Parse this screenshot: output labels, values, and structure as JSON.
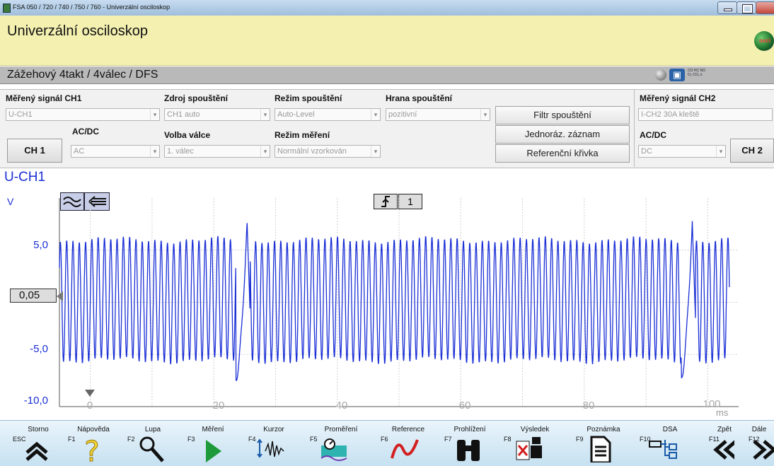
{
  "window": {
    "title": "FSA 050 / 720 / 740 / 750 / 760 - Univerzální osciloskop"
  },
  "app": {
    "title": "Univerzální osciloskop",
    "globe_label": "osci"
  },
  "config": {
    "text": "Zážehový 4takt /  4válec / DFS",
    "gas_icon_text": "CO HC NO O₂ CO₂ λ"
  },
  "panel": {
    "ch1_signal_label": "Měřený signál CH1",
    "ch1_signal_value": "U-CH1",
    "trigger_source_label": "Zdroj spouštění",
    "trigger_source_value": "CH1 auto",
    "trigger_mode_label": "Režim spouštění",
    "trigger_mode_value": "Auto-Level",
    "trigger_edge_label": "Hrana spouštění",
    "trigger_edge_value": "pozitivní",
    "ch1_acdc_label": "AC/DC",
    "ch1_acdc_value": "AC",
    "ch1_button": "CH 1",
    "cylinder_label": "Volba válce",
    "cylinder_value": "1. válec",
    "measure_mode_label": "Režim měření",
    "measure_mode_value": "Normální vzorkován",
    "filter_button": "Filtr spouštění",
    "single_button": "Jednoráz. záznam",
    "reference_button": "Referenční křivka",
    "ch2_signal_label": "Měřený signál CH2",
    "ch2_signal_value": "I-CH2 30A kleště",
    "ch2_acdc_label": "AC/DC",
    "ch2_acdc_value": "DC",
    "ch2_button": "CH 2"
  },
  "scope": {
    "channel": "U-CH1",
    "unit": "V",
    "offset": "0,05",
    "trigger_channel": "1",
    "y_ticks": [
      "5,0",
      "-5,0",
      "-10,0"
    ],
    "x_ticks": [
      "0",
      "20",
      "40",
      "60",
      "80",
      "100"
    ],
    "x_unit": "ms"
  },
  "chart_data": {
    "type": "line",
    "xlabel": "ms",
    "ylabel": "V",
    "xlim": [
      -5,
      105
    ],
    "ylim": [
      -10,
      10
    ],
    "series": [
      {
        "color": "#1a2fd6",
        "oscillation_period_ms": 1.02,
        "high_V": 6.0,
        "low_V": -5.6,
        "spikes_ms": [
          25.4,
          97.5
        ],
        "spike_high_V": 7.6,
        "spike_low_V": -7.4
      }
    ]
  },
  "fkeys": [
    {
      "key": "ESC",
      "label": "Storno",
      "icon": "double-chevron-up-icon"
    },
    {
      "key": "F1",
      "label": "Nápověda",
      "icon": "question-icon"
    },
    {
      "key": "F2",
      "label": "Lupa",
      "icon": "magnifier-icon"
    },
    {
      "key": "F3",
      "label": "Měření",
      "icon": "play-icon"
    },
    {
      "key": "F4",
      "label": "Kurzor",
      "icon": "cursor-icon"
    },
    {
      "key": "F5",
      "label": "Proměření",
      "icon": "measure-icon"
    },
    {
      "key": "F6",
      "label": "Reference",
      "icon": "reference-curve-icon"
    },
    {
      "key": "F7",
      "label": "Prohlížení",
      "icon": "binoculars-icon"
    },
    {
      "key": "F8",
      "label": "Výsledek",
      "icon": "result-icon"
    },
    {
      "key": "F9",
      "label": "Poznámka",
      "icon": "note-icon"
    },
    {
      "key": "F10",
      "label": "DSA",
      "icon": "dsa-icon"
    },
    {
      "key": "F11",
      "label": "Zpět",
      "icon": "back-icon"
    },
    {
      "key": "F12",
      "label": "Dále",
      "icon": "next-icon"
    }
  ]
}
